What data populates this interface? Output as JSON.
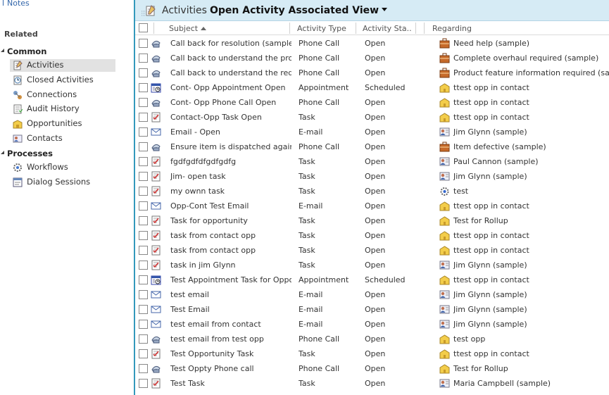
{
  "nav": {
    "notes_label": "Notes",
    "related_label": "Related",
    "sections": [
      {
        "label": "Common",
        "items": [
          {
            "label": "Activities",
            "icon": "activities-icon",
            "selected": true
          },
          {
            "label": "Closed Activities",
            "icon": "closed-activities-icon"
          },
          {
            "label": "Connections",
            "icon": "connections-icon"
          },
          {
            "label": "Audit History",
            "icon": "audit-history-icon"
          },
          {
            "label": "Opportunities",
            "icon": "opportunities-icon"
          },
          {
            "label": "Contacts",
            "icon": "contacts-icon"
          }
        ]
      },
      {
        "label": "Processes",
        "items": [
          {
            "label": "Workflows",
            "icon": "workflows-icon"
          },
          {
            "label": "Dialog Sessions",
            "icon": "dialog-sessions-icon"
          }
        ]
      }
    ]
  },
  "header": {
    "entity": "Activities",
    "view": "Open Activity Associated View"
  },
  "columns": {
    "subject": "Subject",
    "type": "Activity Type",
    "status": "Activity Sta...",
    "regarding": "Regarding"
  },
  "colors": {
    "accent": "#3399bb",
    "header_bg": "#d6ebf5"
  },
  "rows": [
    {
      "subject": "Call back for resolution (sample)",
      "type": "Phone Call",
      "status": "Open",
      "regarding": "Need help (sample)",
      "ricon": "case"
    },
    {
      "subject": "Call back to understand the prob...",
      "type": "Phone Call",
      "status": "Open",
      "regarding": "Complete overhaul required (sample)",
      "ricon": "case"
    },
    {
      "subject": "Call back to understand the requ...",
      "type": "Phone Call",
      "status": "Open",
      "regarding": "Product feature information required (sample)",
      "ricon": "case"
    },
    {
      "subject": "Cont- Opp Appointment Open",
      "type": "Appointment",
      "status": "Scheduled",
      "regarding": "ttest opp in contact",
      "ricon": "opportunity"
    },
    {
      "subject": "Cont- Opp Phone Call Open",
      "type": "Phone Call",
      "status": "Open",
      "regarding": "ttest opp in contact",
      "ricon": "opportunity"
    },
    {
      "subject": "Contact-Opp Task Open",
      "type": "Task",
      "status": "Open",
      "regarding": "ttest opp in contact",
      "ricon": "opportunity"
    },
    {
      "subject": "Email - Open",
      "type": "E-mail",
      "status": "Open",
      "regarding": "Jim Glynn (sample)",
      "ricon": "contact"
    },
    {
      "subject": "Ensure item is dispatched again a...",
      "type": "Phone Call",
      "status": "Open",
      "regarding": "Item defective (sample)",
      "ricon": "case"
    },
    {
      "subject": "fgdfgdfdfgdfgdfg",
      "type": "Task",
      "status": "Open",
      "regarding": "Paul Cannon (sample)",
      "ricon": "contact"
    },
    {
      "subject": "Jim- open task",
      "type": "Task",
      "status": "Open",
      "regarding": "Jim Glynn (sample)",
      "ricon": "contact"
    },
    {
      "subject": "my ownn task",
      "type": "Task",
      "status": "Open",
      "regarding": "test",
      "ricon": "workflow"
    },
    {
      "subject": "Opp-Cont Test Email",
      "type": "E-mail",
      "status": "Open",
      "regarding": "ttest opp in contact",
      "ricon": "opportunity"
    },
    {
      "subject": "Task for opportunity",
      "type": "Task",
      "status": "Open",
      "regarding": "Test for Rollup",
      "ricon": "opportunity"
    },
    {
      "subject": "task from contact opp",
      "type": "Task",
      "status": "Open",
      "regarding": "ttest opp in contact",
      "ricon": "opportunity"
    },
    {
      "subject": "task from contact opp",
      "type": "Task",
      "status": "Open",
      "regarding": "ttest opp in contact",
      "ricon": "opportunity"
    },
    {
      "subject": "task in jim Glynn",
      "type": "Task",
      "status": "Open",
      "regarding": "Jim Glynn (sample)",
      "ricon": "contact"
    },
    {
      "subject": "Test Appointment Task for Oppo...",
      "type": "Appointment",
      "status": "Scheduled",
      "regarding": "ttest opp in contact",
      "ricon": "opportunity"
    },
    {
      "subject": "test email",
      "type": "E-mail",
      "status": "Open",
      "regarding": "Jim Glynn (sample)",
      "ricon": "contact"
    },
    {
      "subject": "Test Email",
      "type": "E-mail",
      "status": "Open",
      "regarding": "Jim Glynn (sample)",
      "ricon": "contact"
    },
    {
      "subject": "test email from contact",
      "type": "E-mail",
      "status": "Open",
      "regarding": "Jim Glynn (sample)",
      "ricon": "contact"
    },
    {
      "subject": "test email from test opp",
      "type": "Phone Call",
      "status": "Open",
      "regarding": "test opp",
      "ricon": "opportunity"
    },
    {
      "subject": "Test Opportunity Task",
      "type": "Task",
      "status": "Open",
      "regarding": "ttest opp in contact",
      "ricon": "opportunity"
    },
    {
      "subject": "Test Oppty Phone call",
      "type": "Phone Call",
      "status": "Open",
      "regarding": "Test for Rollup",
      "ricon": "opportunity"
    },
    {
      "subject": "Test Task",
      "type": "Task",
      "status": "Open",
      "regarding": "Maria Campbell (sample)",
      "ricon": "contact"
    }
  ]
}
